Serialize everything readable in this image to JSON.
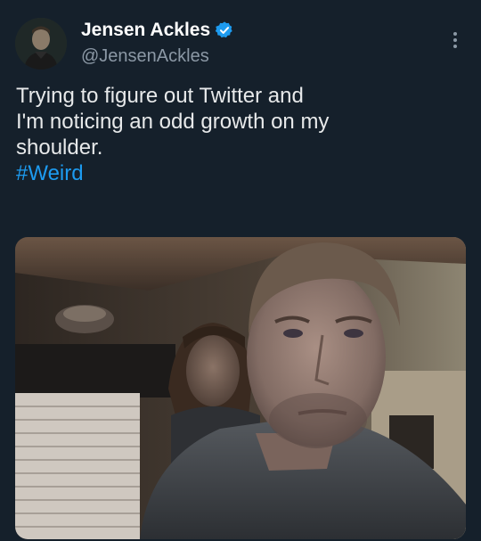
{
  "author": {
    "display_name": "Jensen Ackles",
    "handle": "@JensenAckles",
    "verified": true,
    "verified_icon": "verified-badge-icon"
  },
  "tweet": {
    "lines": [
      "Trying to figure out Twitter and",
      "I'm noticing an odd growth on my",
      "shoulder."
    ],
    "hashtag": "#Weird"
  },
  "colors": {
    "background": "#15202b",
    "text": "#e7e9ea",
    "secondary_text": "#8b98a5",
    "link": "#1d9bf0",
    "verified": "#1d9bf0"
  },
  "icons": {
    "more": "more-options-icon"
  }
}
